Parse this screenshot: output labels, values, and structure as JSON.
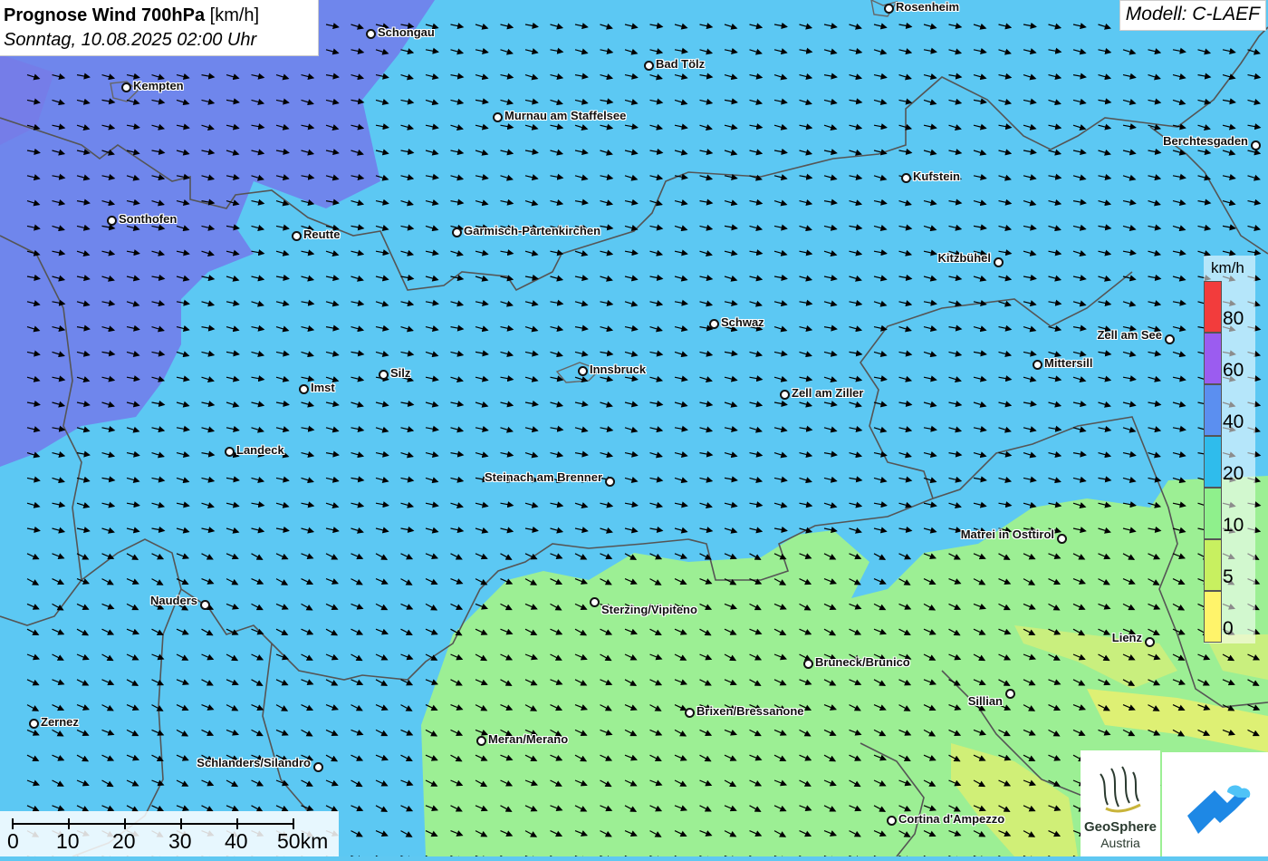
{
  "title": {
    "main": "Prognose Wind 700hPa",
    "unit": "[km/h]",
    "date": "Sonntag, 10.08.2025 02:00 Uhr"
  },
  "model": "Modell: C-LAEF",
  "cities": [
    {
      "name": "Rosenheim"
    },
    {
      "name": "Schongau"
    },
    {
      "name": "Bad Tölz"
    },
    {
      "name": "Kempten"
    },
    {
      "name": "Murnau am Staffelsee"
    },
    {
      "name": "Berchtesgaden"
    },
    {
      "name": "Kufstein"
    },
    {
      "name": "Sonthofen"
    },
    {
      "name": "Reutte"
    },
    {
      "name": "Garmisch-Partenkirchen"
    },
    {
      "name": "Kitzbühel"
    },
    {
      "name": "Schwaz"
    },
    {
      "name": "Zell am See"
    },
    {
      "name": "Mittersill"
    },
    {
      "name": "Silz"
    },
    {
      "name": "Innsbruck"
    },
    {
      "name": "Imst"
    },
    {
      "name": "Zell am Ziller"
    },
    {
      "name": "Landeck"
    },
    {
      "name": "Steinach am Brenner"
    },
    {
      "name": "Matrei in Osttirol"
    },
    {
      "name": "Nauders"
    },
    {
      "name": "Sterzing/Vipiteno"
    },
    {
      "name": "Lienz"
    },
    {
      "name": "Bruneck/Brunico"
    },
    {
      "name": "Sillian"
    },
    {
      "name": "Brixen/Bressanone"
    },
    {
      "name": "Zernez"
    },
    {
      "name": "Meran/Merano"
    },
    {
      "name": "Schlanders/Silandro"
    },
    {
      "name": "Cortina d'Ampezzo"
    }
  ],
  "legend": {
    "unit": "km/h",
    "classes": [
      {
        "label": "80",
        "color": "#f23c3c"
      },
      {
        "label": "60",
        "color": "#9b5cf0"
      },
      {
        "label": "40",
        "color": "#5b8ff0"
      },
      {
        "label": "20",
        "color": "#2fbcec"
      },
      {
        "label": "10",
        "color": "#8ff08c"
      },
      {
        "label": "5",
        "color": "#c8f060"
      },
      {
        "label": "0",
        "color": "#fff46a"
      }
    ]
  },
  "scale": {
    "labels": [
      "0",
      "10",
      "20",
      "30",
      "40",
      "50km"
    ]
  },
  "logo": {
    "name1": "GeoSphere",
    "name2": "Austria"
  },
  "colors": {
    "wind_10_20": "#5cc8f3",
    "wind_20_40": "#6e8ff0",
    "wind_5_10": "#9cef94",
    "wind_0_5": "#e6ef70"
  }
}
